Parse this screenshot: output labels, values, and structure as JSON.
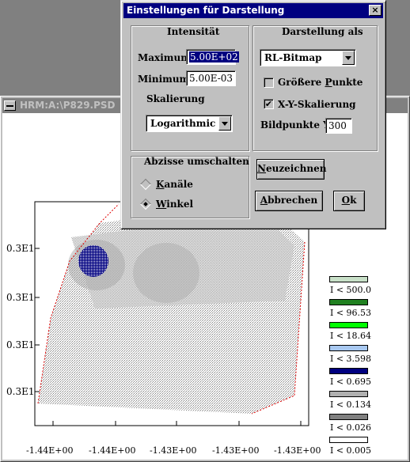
{
  "plot_window": {
    "title": "HRM:A:\\P829.PSD",
    "y_ticks": [
      "0.3E1",
      "0.3E1",
      "0.3E1",
      "0.3E1"
    ],
    "x_ticks": [
      "-1.44E+00",
      "-1.44E+00",
      "-1.43E+00",
      "-1.43E+00",
      "-1.43E+00"
    ],
    "legend": [
      {
        "label": "I < 500.0",
        "color": "#c8e0c8"
      },
      {
        "label": "I < 96.53",
        "color": "#208020"
      },
      {
        "label": "I < 18.64",
        "color": "#00ff00"
      },
      {
        "label": "I < 3.598",
        "color": "#a8c8f0"
      },
      {
        "label": "I < 0.695",
        "color": "#000080"
      },
      {
        "label": "I < 0.134",
        "color": "#b0b0b0"
      },
      {
        "label": "I < 0.026",
        "color": "#808080"
      },
      {
        "label": "I < 0.005",
        "color": "#ffffff"
      }
    ]
  },
  "dialog": {
    "title": "Einstellungen für Darstellung",
    "close_glyph": "×",
    "intensity": {
      "label": "Intensität",
      "maximum_label": "Maximum",
      "maximum_value": "5.00E+02",
      "minimum_label": "Minimum",
      "minimum_value": "5.00E-03",
      "scaling_label": "Skalierung",
      "scaling_value": "Logarithmic"
    },
    "display": {
      "label": "Darstellung als",
      "mode_value": "RL-Bitmap",
      "bigger_points_pre": "Größere ",
      "bigger_points_u": "P",
      "bigger_points_post": "unkte",
      "bigger_points_checked": false,
      "xy_scaling_label": "X-Y-Skalierung",
      "xy_scaling_check": "✔",
      "pixels_y_label": "Bildpunkte Y",
      "pixels_y_value": "300"
    },
    "abscissa": {
      "label": "Abzisse umschalten",
      "channels_u": "K",
      "channels_rest": "anäle",
      "angle_u": "W",
      "angle_rest": "inkel"
    },
    "buttons": {
      "redraw_u": "N",
      "redraw_rest": "euzeichnen",
      "cancel_u": "A",
      "cancel_rest": "bbrechen",
      "ok_u": "O",
      "ok_rest": "k"
    }
  }
}
